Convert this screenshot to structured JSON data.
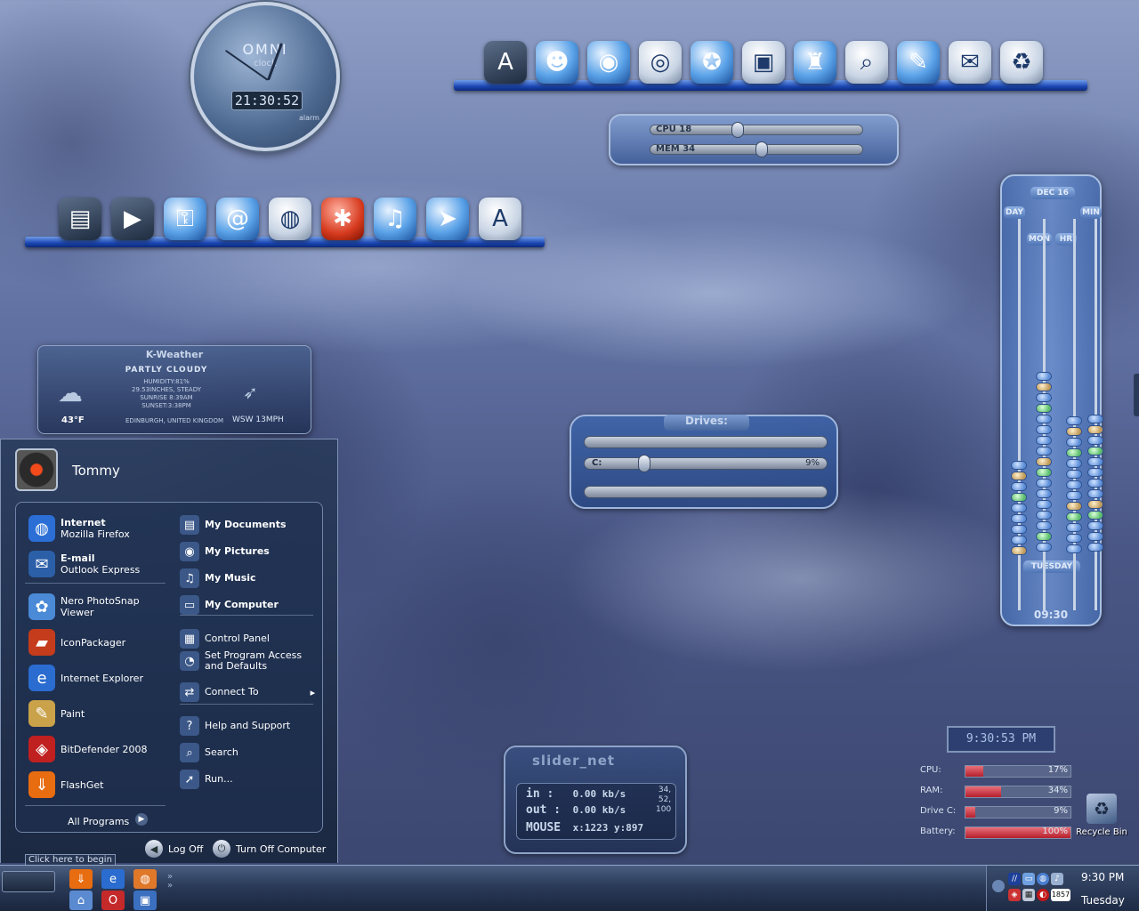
{
  "clock": {
    "brand": "OMNI",
    "sub": "clock",
    "digital": "21:30:52",
    "alarm": "alarm"
  },
  "top_dock": {
    "icons": [
      {
        "name": "acrobat-icon",
        "glyph": "A",
        "style": "dark"
      },
      {
        "name": "messenger-robot-icon",
        "glyph": "☻",
        "style": ""
      },
      {
        "name": "robot-icon",
        "glyph": "◉",
        "style": ""
      },
      {
        "name": "webcam-icon",
        "glyph": "◎",
        "style": "white"
      },
      {
        "name": "firefox-icon",
        "glyph": "✪",
        "style": ""
      },
      {
        "name": "photos-icon",
        "glyph": "▣",
        "style": "white"
      },
      {
        "name": "joystick-icon",
        "glyph": "♜",
        "style": ""
      },
      {
        "name": "search-icon",
        "glyph": "⌕",
        "style": "white"
      },
      {
        "name": "gimp-icon",
        "glyph": "✎",
        "style": ""
      },
      {
        "name": "messenger-icon",
        "glyph": "✉",
        "style": "white"
      },
      {
        "name": "recycle-bin-icon",
        "glyph": "♻",
        "style": "white"
      }
    ]
  },
  "left_dock": {
    "icons": [
      {
        "name": "task-manager-icon",
        "glyph": "▤",
        "style": "dark"
      },
      {
        "name": "media-player-icon",
        "glyph": "▶",
        "style": "dark"
      },
      {
        "name": "key-icon",
        "glyph": "⚿",
        "style": ""
      },
      {
        "name": "email-icon",
        "glyph": "@",
        "style": ""
      },
      {
        "name": "globe-icon",
        "glyph": "◍",
        "style": "white"
      },
      {
        "name": "game-icon",
        "glyph": "✱",
        "style": "red"
      },
      {
        "name": "music-icon",
        "glyph": "♫",
        "style": ""
      },
      {
        "name": "messenger-plane-icon",
        "glyph": "➤",
        "style": ""
      },
      {
        "name": "pdf-icon",
        "glyph": "A",
        "style": "white"
      }
    ]
  },
  "sysbars": {
    "cpu_label": "CPU 18",
    "mem_label": "MEM 34",
    "cpu": 18,
    "mem": 34
  },
  "weather": {
    "title": "K-Weather",
    "condition": "PARTLY CLOUDY",
    "details": [
      "HUMIDITY:81%",
      "29.53INCHES, STEADY",
      "SUNRISE 8:39AM",
      "SUNSET:3:38PM"
    ],
    "temp": "43°F",
    "location": "EDINBURGH, UNITED KINGDOM",
    "wind": "WSW 13MPH"
  },
  "start_menu": {
    "user": "Tommy",
    "left_items": [
      {
        "name": "internet",
        "t1": "Internet",
        "t2": "Mozilla Firefox",
        "glyph": "◍",
        "color": "#2b6fd6"
      },
      {
        "name": "email",
        "t1": "E-mail",
        "t2": "Outlook Express",
        "glyph": "✉",
        "color": "#2b5fa8"
      },
      {
        "name": "nero-photosnap",
        "t1": "",
        "t2": "Nero PhotoSnap Viewer",
        "glyph": "✿",
        "color": "#4a8ad6"
      },
      {
        "name": "iconpackager",
        "t1": "",
        "t2": "IconPackager",
        "glyph": "▰",
        "color": "#c43c1c"
      },
      {
        "name": "internet-explorer",
        "t1": "",
        "t2": "Internet Explorer",
        "glyph": "e",
        "color": "#2a6cd0"
      },
      {
        "name": "paint",
        "t1": "",
        "t2": "Paint",
        "glyph": "✎",
        "color": "#c9a24a"
      },
      {
        "name": "bitdefender",
        "t1": "",
        "t2": "BitDefender 2008",
        "glyph": "◈",
        "color": "#c02020"
      },
      {
        "name": "flashget",
        "t1": "",
        "t2": "FlashGet",
        "glyph": "⇓",
        "color": "#e86c10"
      }
    ],
    "right_items": [
      {
        "name": "my-documents",
        "label": "My Documents",
        "glyph": "▤",
        "bold": true
      },
      {
        "name": "my-pictures",
        "label": "My Pictures",
        "glyph": "◉",
        "bold": true
      },
      {
        "name": "my-music",
        "label": "My Music",
        "glyph": "♫",
        "bold": true
      },
      {
        "name": "my-computer",
        "label": "My Computer",
        "glyph": "▭",
        "bold": true
      },
      {
        "name": "control-panel",
        "label": "Control Panel",
        "glyph": "▦",
        "bold": false
      },
      {
        "name": "set-program-access",
        "label": "Set Program Access and Defaults",
        "glyph": "◔",
        "bold": false
      },
      {
        "name": "connect-to",
        "label": "Connect To",
        "glyph": "⇄",
        "bold": false
      },
      {
        "name": "help-and-support",
        "label": "Help and Support",
        "glyph": "?",
        "bold": false
      },
      {
        "name": "search",
        "label": "Search",
        "glyph": "⌕",
        "bold": false
      },
      {
        "name": "run",
        "label": "Run...",
        "glyph": "➚",
        "bold": false
      }
    ],
    "all_programs": "All Programs",
    "log_off": "Log Off",
    "turn_off": "Turn Off Computer"
  },
  "tooltip": "Click here to begin",
  "drives": {
    "title": "Drives:",
    "drive_label": "C:",
    "drive_pct": "9%",
    "drive_value": 9
  },
  "abacus": {
    "date": "DEC 16",
    "labels": {
      "day": "DAY",
      "min": "MIN",
      "mon": "MON",
      "hr": "HR",
      "weekday": "TUESDAY"
    },
    "time": "09:30"
  },
  "slider_net": {
    "title": "slider_net",
    "in_label": "in :",
    "in_value": "0.00 kb/s",
    "out_label": "out :",
    "out_value": "0.00 kb/s",
    "mouse_label": "MOUSE",
    "mouse_value": "x:1223 y:897",
    "side": [
      "34,",
      "52,",
      "100"
    ]
  },
  "sysmeter": {
    "clock": "9:30:53 PM",
    "rows": [
      {
        "label": "CPU:",
        "value": 17,
        "text": "17%"
      },
      {
        "label": "RAM:",
        "value": 34,
        "text": "34%"
      },
      {
        "label": "Drive C:",
        "value": 9,
        "text": "9%"
      },
      {
        "label": "Battery:",
        "value": 100,
        "text": "100%"
      }
    ]
  },
  "recycle_bin": {
    "label": "Recycle Bin"
  },
  "taskbar": {
    "quicklaunch": [
      {
        "name": "flashget-quicklaunch",
        "glyph": "⇓",
        "color": "#e86c10"
      },
      {
        "name": "ie-quicklaunch",
        "glyph": "e",
        "color": "#2a6cd0"
      },
      {
        "name": "firefox-quicklaunch",
        "glyph": "◍",
        "color": "#e0782a"
      },
      {
        "name": "network-quicklaunch",
        "glyph": "⌂",
        "color": "#5a8ad0"
      },
      {
        "name": "opera-quicklaunch",
        "glyph": "O",
        "color": "#c42a2a"
      },
      {
        "name": "desktop-quicklaunch",
        "glyph": "▣",
        "color": "#3b6fbf"
      }
    ],
    "time": "9:30 PM",
    "day": "Tuesday",
    "tray_badge": "1857"
  }
}
